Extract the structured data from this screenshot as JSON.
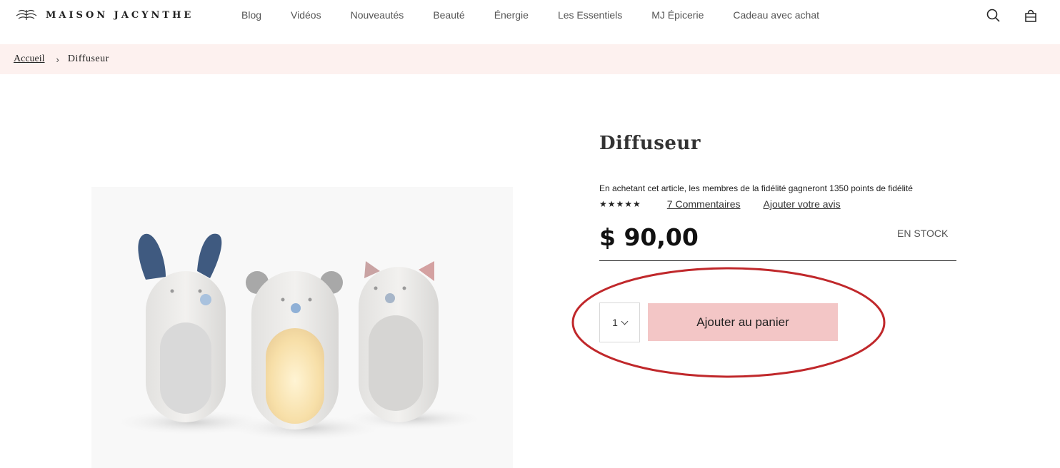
{
  "header": {
    "logo_text": "MAISON JACYNTHE",
    "nav": [
      "Blog",
      "Vidéos",
      "Nouveautés",
      "Beauté",
      "Énergie",
      "Les Essentiels",
      "MJ Épicerie",
      "Cadeau avec achat"
    ],
    "icons": [
      "search-icon",
      "shopping-bag-icon"
    ]
  },
  "breadcrumb": {
    "home": "Accueil",
    "separator": "›",
    "current": "Diffuseur"
  },
  "product": {
    "title": "Diffuseur",
    "loyalty_text": "En achetant cet article, les membres de la fidélité gagneront 1350 points de fidélité",
    "stars": "★★★★★",
    "rating": 4.5,
    "reviews_link": "7 Commentaires",
    "add_review_link": "Ajouter votre avis",
    "price": "$ 90,00",
    "stock": "EN STOCK",
    "quantity": "1",
    "add_to_cart": "Ajouter au panier"
  },
  "colors": {
    "breadcrumb_bg": "#fdf1ef",
    "add_to_cart_bg": "#f3c6c6",
    "annotation_ellipse": "#c0282b"
  }
}
